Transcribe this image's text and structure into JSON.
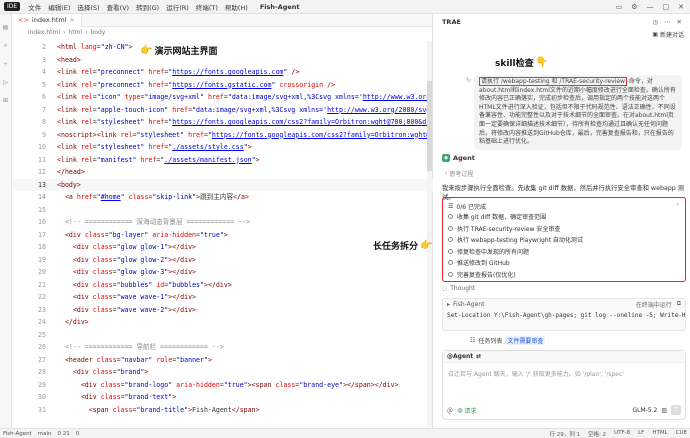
{
  "titlebar": {
    "ide_badge": "IDE",
    "menu": [
      "文件",
      "编辑(E)",
      "选择(S)",
      "查看(V)",
      "转到(G)",
      "运行(R)",
      "终端(T)",
      "帮助(H)"
    ],
    "app_title": "Fish-Agent"
  },
  "editor": {
    "tab_label": "index.html",
    "breadcrumb": [
      "index.html",
      "html",
      "body"
    ],
    "lines": [
      {
        "n": "2"
      },
      {
        "n": "3"
      },
      {
        "n": "4"
      },
      {
        "n": "5"
      },
      {
        "n": "6"
      },
      {
        "n": "7"
      },
      {
        "n": "8"
      },
      {
        "n": "9"
      },
      {
        "n": "10"
      },
      {
        "n": "11"
      },
      {
        "n": "12"
      },
      {
        "n": "13"
      },
      {
        "n": "14"
      },
      {
        "n": "15"
      },
      {
        "n": "16"
      },
      {
        "n": "17"
      },
      {
        "n": "18"
      },
      {
        "n": "19"
      },
      {
        "n": "20"
      },
      {
        "n": "21"
      },
      {
        "n": "22"
      },
      {
        "n": "23"
      },
      {
        "n": "24"
      },
      {
        "n": "25"
      },
      {
        "n": "26"
      },
      {
        "n": "27"
      },
      {
        "n": "28"
      },
      {
        "n": "29"
      },
      {
        "n": "30"
      },
      {
        "n": "31"
      }
    ],
    "annotation_top": "演示网站主界面",
    "annotation_task": "长任务拆分"
  },
  "panel": {
    "title": "TRAE",
    "new_chat": "新建对话",
    "skill_note": "skill检查",
    "user_message_pre": "请执行 /webapp-testing 和 /TRAE-security-review 命令，对about.html和index.html文件的近期小幅度修改进行全面检查。确认所有修改内容已正确落实，完成初步检查后，调用指定的两个技能对这两个HTML文件进行深入验证，包括但不限于代码规范性、语法正确性、不同设备兼容性、功能完整性以及对于技术细节的全面审查。在对about.html页面一定要确保详细描述技术细节），待所有检查均通过且确认无任何问题后，将修改内容推送到GitHub仓库，最后，完善复查报告和，只在报告的粘基础上进行优化。",
    "user_message_hl": "请执行 /webapp-testing 和 /TRAE-security-review",
    "user_message_rest": " 命令，对about.html和index.html文件的近期小幅度修改进行全面检查。确认所有修改内容已正确落实，完成初步检查后，调用指定的两个技能对这两个HTML文件进行深入验证，包括但不限于代码规范性、语法正确性、不同设备兼容性、功能完整性以及对于技术细节的全面审查。在对about.html页面一定要确保详细描述技术细节），待所有检查均通过且确认无任何问题后，将修改内容推送到GitHub仓库，最后，完善复查报告和，只在报告的粘基础上进行优化。",
    "agent_label": "Agent",
    "thinking": "思考过程",
    "plan_text": "我来按步骤执行全面检查。先收集 git diff 数据，然后并行执行安全审查和 webapp 测试。",
    "task_progress": "0/6 已完成",
    "tasks": [
      "收集 git diff 数据，确定审查范围",
      "执行 TRAE-security-review 安全审查",
      "执行 webapp-testing Playwright 自动化测试",
      "修复检查中发现的所有问题",
      "推送修改到 GitHub",
      "完善复查报告(仅优化)"
    ],
    "thought_label": "Thought",
    "terminal_title": "Fish-Agent",
    "terminal_right": "在终端中运行",
    "terminal_cmd": "Set-Location Y:\\Fish-Agent\\gh-pages; git log --oneline -5; Write-Host \"=== DIFF STAT ===\"",
    "queue_label": "任务列表",
    "queue_link": "文件需要审查",
    "input_mention": "@Agent",
    "input_placeholder": "召迁若与 Agent 聊天，输入 '/' 获取更多能力。如 '/plan', '/spec'",
    "input_mode": "请求",
    "model": "GLM-5.2"
  },
  "statusbar": {
    "left": [
      "Fish-Agent",
      "main",
      "0 21",
      "0"
    ],
    "right": [
      "行 29，列 1",
      "空格: 2",
      "UTF-8",
      "LF",
      "HTML",
      "CUE"
    ]
  }
}
